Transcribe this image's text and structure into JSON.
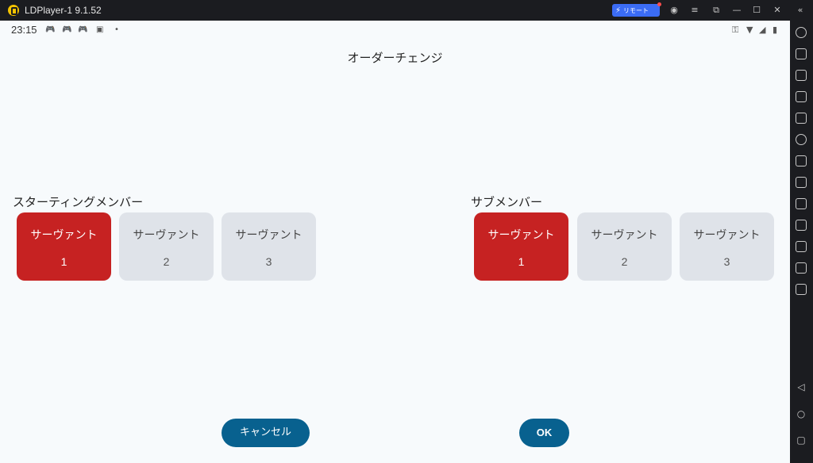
{
  "window": {
    "title": "LDPlayer-1 9.1.52",
    "remote_label": "リモート"
  },
  "statusbar": {
    "time": "23:15"
  },
  "page": {
    "title": "オーダーチェンジ"
  },
  "starting_members": {
    "label": "スターティングメンバー",
    "cards": [
      {
        "name": "サーヴァント",
        "number": "1",
        "selected": true
      },
      {
        "name": "サーヴァント",
        "number": "2",
        "selected": false
      },
      {
        "name": "サーヴァント",
        "number": "3",
        "selected": false
      }
    ]
  },
  "sub_members": {
    "label": "サブメンバー",
    "cards": [
      {
        "name": "サーヴァント",
        "number": "1",
        "selected": true
      },
      {
        "name": "サーヴァント",
        "number": "2",
        "selected": false
      },
      {
        "name": "サーヴァント",
        "number": "3",
        "selected": false
      }
    ]
  },
  "buttons": {
    "cancel": "キャンセル",
    "ok": "OK"
  },
  "colors": {
    "selected_card": "#c62222",
    "card": "#dfe3e9",
    "button": "#08618f",
    "screen_bg": "#f7fafc"
  }
}
